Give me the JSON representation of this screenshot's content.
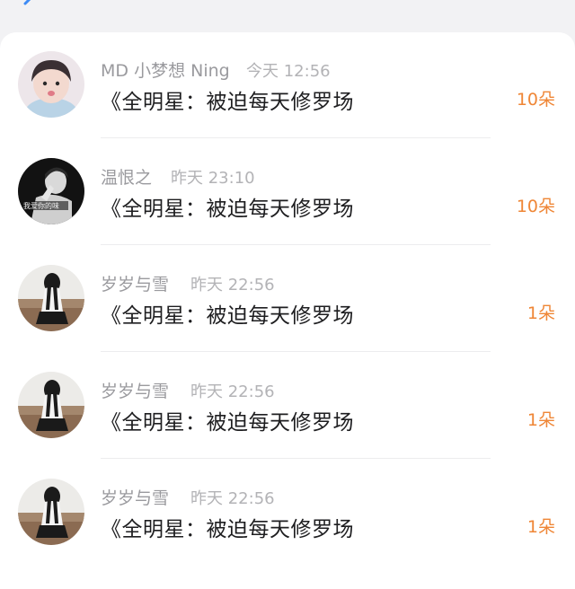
{
  "header": {
    "back_icon": "chevron-left-icon"
  },
  "gift_list": {
    "items": [
      {
        "sender": "MD 小梦想 Ning",
        "time": "今天 12:56",
        "book": "《全明星：被迫每天修罗场",
        "count": "10朵",
        "avatar": "girl-portrait-avatar"
      },
      {
        "sender": "温恨之",
        "time": "昨天 23:10",
        "book": "《全明星：被迫每天修罗场",
        "count": "10朵",
        "avatar": "dark-photo-avatar"
      },
      {
        "sender": "岁岁与雪",
        "time": "昨天 22:56",
        "book": "《全明星：被迫每天修罗场",
        "count": "1朵",
        "avatar": "girl-back-avatar"
      },
      {
        "sender": "岁岁与雪",
        "time": "昨天 22:56",
        "book": "《全明星：被迫每天修罗场",
        "count": "1朵",
        "avatar": "girl-back-avatar"
      },
      {
        "sender": "岁岁与雪",
        "time": "昨天 22:56",
        "book": "《全明星：被迫每天修罗场",
        "count": "1朵",
        "avatar": "girl-back-avatar"
      }
    ]
  },
  "colors": {
    "count_orange": "#ef8636",
    "name_gray": "#9a9a9e",
    "back_blue": "#3d8bf5"
  }
}
